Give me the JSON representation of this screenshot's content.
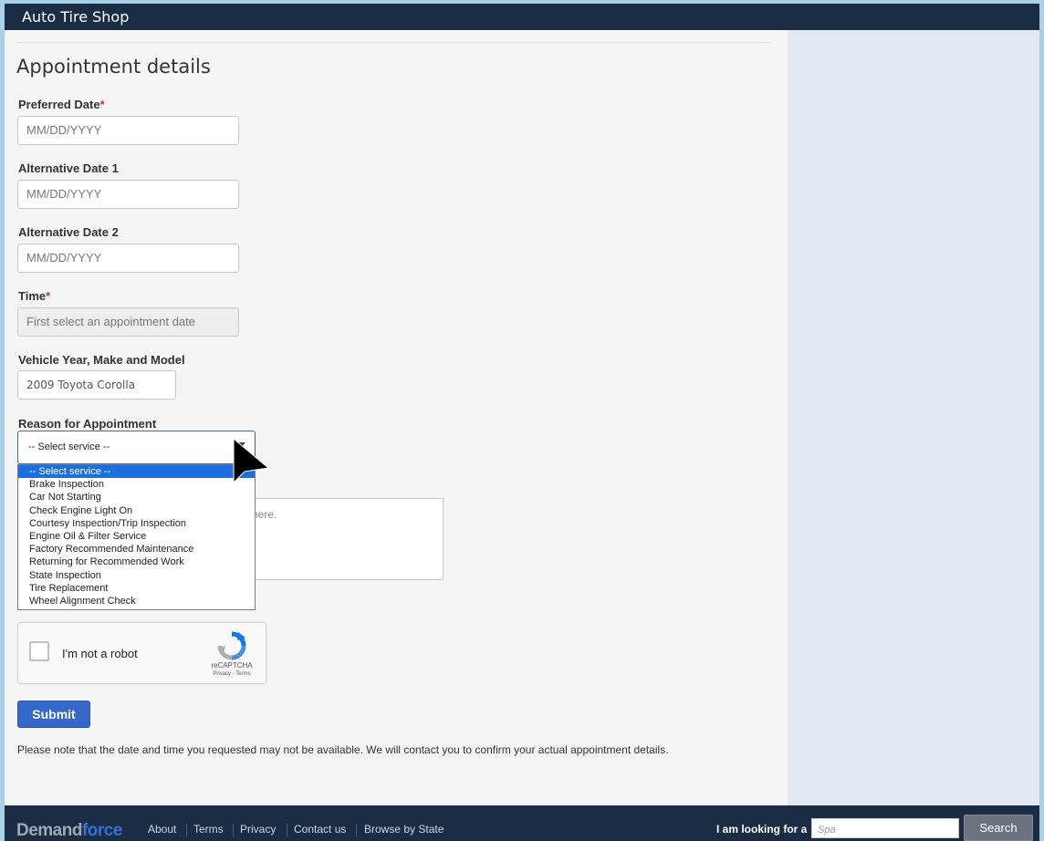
{
  "app": {
    "title": "Auto Tire Shop"
  },
  "form": {
    "heading": "Appointment details",
    "preferred_date": {
      "label": "Preferred Date",
      "required_mark": "*",
      "placeholder": "MM/DD/YYYY"
    },
    "alt_date_1": {
      "label": "Alternative Date 1",
      "placeholder": "MM/DD/YYYY"
    },
    "alt_date_2": {
      "label": "Alternative Date 2",
      "placeholder": "MM/DD/YYYY"
    },
    "time": {
      "label": "Time",
      "required_mark": "*",
      "placeholder": "First select an appointment date"
    },
    "vehicle": {
      "label": "Vehicle Year, Make and Model",
      "value": "2009 Toyota Corolla"
    },
    "reason": {
      "label": "Reason for Appointment",
      "selected": "-- Select service --",
      "options": [
        "-- Select service --",
        "Brake Inspection",
        "Car Not Starting",
        "Check Engine Light On",
        "Courtesy Inspection/Trip Inspection",
        "Engine Oil & Filter Service",
        "Factory Recommended Maintenance",
        "Returning for Recommended Work",
        "State Inspection",
        "Tire Replacement",
        "Wheel Alignment Check"
      ]
    },
    "comments_placeholder_visible": "here.",
    "captcha": {
      "text": "I'm not a robot",
      "brand": "reCAPTCHA",
      "links": "Privacy - Terms"
    },
    "submit_label": "Submit",
    "note": "Please note that the date and time you requested may not be available. We will contact you to confirm your actual appointment details."
  },
  "footer": {
    "logo_demand": "Demand",
    "logo_force": "force",
    "links": [
      "About",
      "Terms",
      "Privacy",
      "Contact us",
      "Browse by State"
    ],
    "search_label": "I am looking for a",
    "search_placeholder": "Spa",
    "search_button": "Search"
  },
  "colors": {
    "header": "#1b2d45",
    "accent": "#3668c9",
    "selected_option": "#1c6fe0",
    "required": "#c0392b"
  }
}
